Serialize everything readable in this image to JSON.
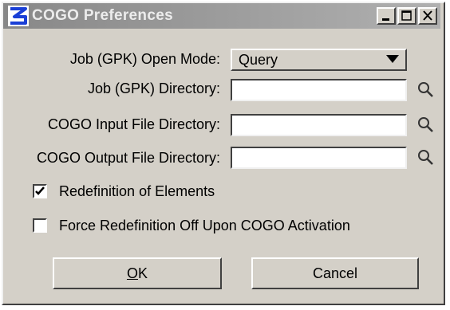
{
  "window": {
    "title": "COGO Preferences",
    "controls": {
      "minimize": "minimize-icon",
      "maximize": "maximize-icon",
      "close": "close-icon"
    }
  },
  "form": {
    "open_mode": {
      "label": "Job (GPK) Open Mode:",
      "value": "Query"
    },
    "job_dir": {
      "label": "Job (GPK) Directory:",
      "value": ""
    },
    "input_dir": {
      "label": "COGO Input File Directory:",
      "value": ""
    },
    "output_dir": {
      "label": "COGO Output File Directory:",
      "value": ""
    },
    "redefinition": {
      "label": "Redefinition of Elements",
      "checked": true
    },
    "force_off": {
      "label": "Force Redefinition Off Upon COGO Activation",
      "checked": false
    }
  },
  "buttons": {
    "ok_mnemonic": "O",
    "ok_rest": "K",
    "cancel": "Cancel"
  },
  "colors": {
    "dialog": "#d4d0c8",
    "title_bar": "#a0a0a0",
    "app_icon": "#1a3fd6"
  }
}
